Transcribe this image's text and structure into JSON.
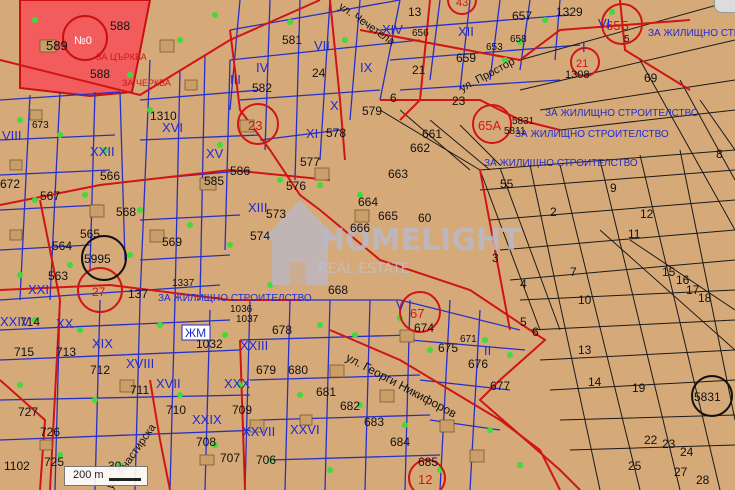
{
  "map": {
    "streets": [
      {
        "key": "s1",
        "text": "ул. Чечетела"
      },
      {
        "key": "s2",
        "text": "ул. Простор"
      },
      {
        "key": "s3",
        "text": "ул. Георги Никифоров"
      },
      {
        "key": "s4",
        "text": "ул. Анастирска"
      }
    ],
    "zone_labels": [
      {
        "key": "z1",
        "text": "ЗА ЖИЛИЩНО СТРОИТЕЛСТВО"
      },
      {
        "key": "z2",
        "text": "ЗА ЖИЛИЩНО СТРОИТЕЛСТВО"
      },
      {
        "key": "z3",
        "text": "ЗА ЖИЛИЩНО СТРОИТЕЛСТВО"
      },
      {
        "key": "z4",
        "text": "ЗА ЖИЛИЩНО СТРОИТЕЛСТВО"
      },
      {
        "key": "z5",
        "text": "ЗА ЖИЛИЩНО СТРОИТЕЛСТВО"
      },
      {
        "key": "z6",
        "text": "ЗА ЦЪРКВА"
      },
      {
        "key": "z7",
        "text": "ЗА ЧЕРКВА"
      }
    ],
    "parcels": [
      "581",
      "582",
      "588",
      "24",
      "578",
      "577",
      "576",
      "579",
      "585",
      "586",
      "574",
      "664",
      "665",
      "663",
      "666",
      "668",
      "661",
      "662",
      "573",
      "1310",
      "23",
      "672",
      "566",
      "568",
      "569",
      "567",
      "563",
      "564",
      "565",
      "137",
      "1337",
      "1036",
      "1037",
      "678",
      "679",
      "680",
      "681",
      "682",
      "683",
      "684",
      "685",
      "1032",
      "674",
      "675",
      "676",
      "677",
      "673",
      "671",
      "715",
      "713",
      "712",
      "711",
      "710",
      "714",
      "709",
      "708",
      "707",
      "706",
      "727",
      "726",
      "725",
      "1102",
      "30",
      "60",
      "55",
      "2",
      "3",
      "4",
      "5",
      "6",
      "7",
      "8",
      "9",
      "10",
      "11",
      "12",
      "13",
      "14",
      "15",
      "16",
      "17",
      "18",
      "19",
      "22",
      "23",
      "24",
      "25",
      "27",
      "28",
      "69",
      "657",
      "658",
      "659",
      "653",
      "1329",
      "1308",
      "21",
      "656",
      "13",
      "5831",
      "5811",
      "5",
      "588",
      "6"
    ],
    "blocks": [
      "VII",
      "VIII",
      "XI",
      "XII",
      "XIII",
      "XIV",
      "XV",
      "XVI",
      "XVII",
      "XVIII",
      "XIX",
      "XX",
      "XXI",
      "XXII",
      "XXIII",
      "XXIV",
      "XXVI",
      "XXVII",
      "XXIX",
      "XXX",
      "IX",
      "X",
      "II",
      "III",
      "IV",
      "V",
      "VI",
      "I"
    ],
    "circle_labels": [
      {
        "key": "c23",
        "text": "23"
      },
      {
        "key": "c65a",
        "text": "65A"
      },
      {
        "key": "c67",
        "text": "67"
      },
      {
        "key": "c12",
        "text": "12"
      },
      {
        "key": "c65b",
        "text": "65Б"
      },
      {
        "key": "c21",
        "text": "21"
      },
      {
        "key": "c5995",
        "text": "5995"
      },
      {
        "key": "c5831",
        "text": "5831"
      },
      {
        "key": "c27",
        "text": "27"
      },
      {
        "key": "c43",
        "text": "43"
      }
    ],
    "special": {
      "zhm": "ЖМ",
      "church": "589",
      "church_sub": "№0"
    },
    "watermark": {
      "text": "HOMELIGHT",
      "sub": "REAL ESTATE"
    },
    "scale": {
      "label": "200 m"
    },
    "colors": {
      "land": "#d6a979",
      "blue": "#1e2bd6",
      "red": "#d01515",
      "church": "#f25c5c",
      "tree": "#3ddc36",
      "building": "#c99e68"
    }
  }
}
